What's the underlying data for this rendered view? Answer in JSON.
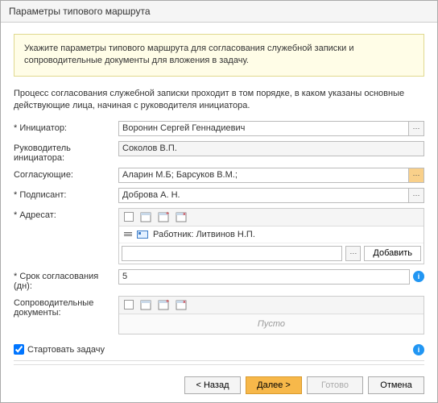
{
  "title": "Параметры типового маршрута",
  "notice": "Укажите параметры типового маршрута для согласования служебной записки и сопроводительные документы для вложения в задачу.",
  "process_text": "Процесс согласования служебной записки проходит в том порядке, в каком указаны основные действующие лица, начиная с руководителя инициатора.",
  "labels": {
    "initiator": "* Инициатор:",
    "manager": "Руководитель инициатора:",
    "approvers": "Согласующие:",
    "signer": "* Подписант:",
    "addressee": "* Адресат:",
    "deadline": "* Срок согласования (дн):",
    "docs": "Сопроводительные документы:",
    "start_task": "Стартовать задачу"
  },
  "values": {
    "initiator": "Воронин Сергей Геннадиевич",
    "manager": "Соколов В.П.",
    "approvers": "Аларин М.Б; Барсуков В.М.;",
    "signer": "Доброва А. Н.",
    "addressee_row": "Работник: Литвинов Н.П.",
    "deadline": "5",
    "empty": "Пусто",
    "add": "Добавить"
  },
  "buttons": {
    "back": "< Назад",
    "next": "Далее >",
    "done": "Готово",
    "cancel": "Отмена"
  },
  "start_checked": true
}
